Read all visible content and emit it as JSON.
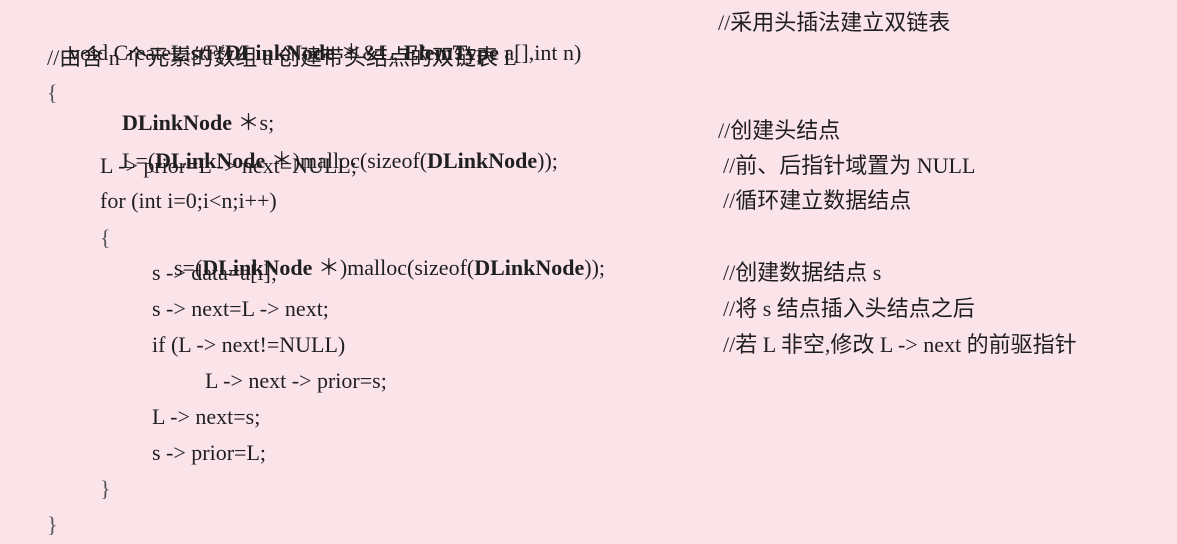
{
  "code": {
    "l1": {
      "a": "void CreateListF(",
      "b": "DLinkNode",
      "c": " ＊&L, ",
      "d": "ElemType",
      "e": " a[],int n)",
      "comment": "//采用头插法建立双链表"
    },
    "l2": {
      "text": "//由含 n 个元素的数组 a 创建带头结点的双链表 L"
    },
    "l3": {
      "brace": "{",
      "b": "DLinkNode",
      "c": " ＊s;"
    },
    "l4": {
      "a": "L=(",
      "b": "DLinkNode",
      "c": " ＊)malloc(sizeof(",
      "d": "DLinkNode",
      "e": "));",
      "comment": "//创建头结点"
    },
    "l5": {
      "text": "L -> prior=L -> next=NULL;",
      "comment": "//前、后指针域置为 NULL"
    },
    "l6": {
      "text": "for (int i=0;i<n;i++)",
      "comment": "//循环建立数据结点"
    },
    "l7": {
      "brace": "{",
      "a": "s=(",
      "b": "DLinkNode",
      "c": " ＊)malloc(sizeof(",
      "d": "DLinkNode",
      "e": "));"
    },
    "l8": {
      "text": "s -> data=a[i];",
      "comment": "//创建数据结点 s"
    },
    "l9": {
      "text": "s -> next=L -> next;",
      "comment": "//将 s 结点插入头结点之后"
    },
    "l10": {
      "text": "if (L -> next!=NULL)",
      "comment": "//若 L 非空,修改 L -> next 的前驱指针"
    },
    "l11": {
      "text": "L -> next -> prior=s;"
    },
    "l12": {
      "text": "L -> next=s;"
    },
    "l13": {
      "text": "s -> prior=L;"
    },
    "l14": {
      "brace": "}"
    },
    "l15": {
      "brace": "}"
    }
  }
}
